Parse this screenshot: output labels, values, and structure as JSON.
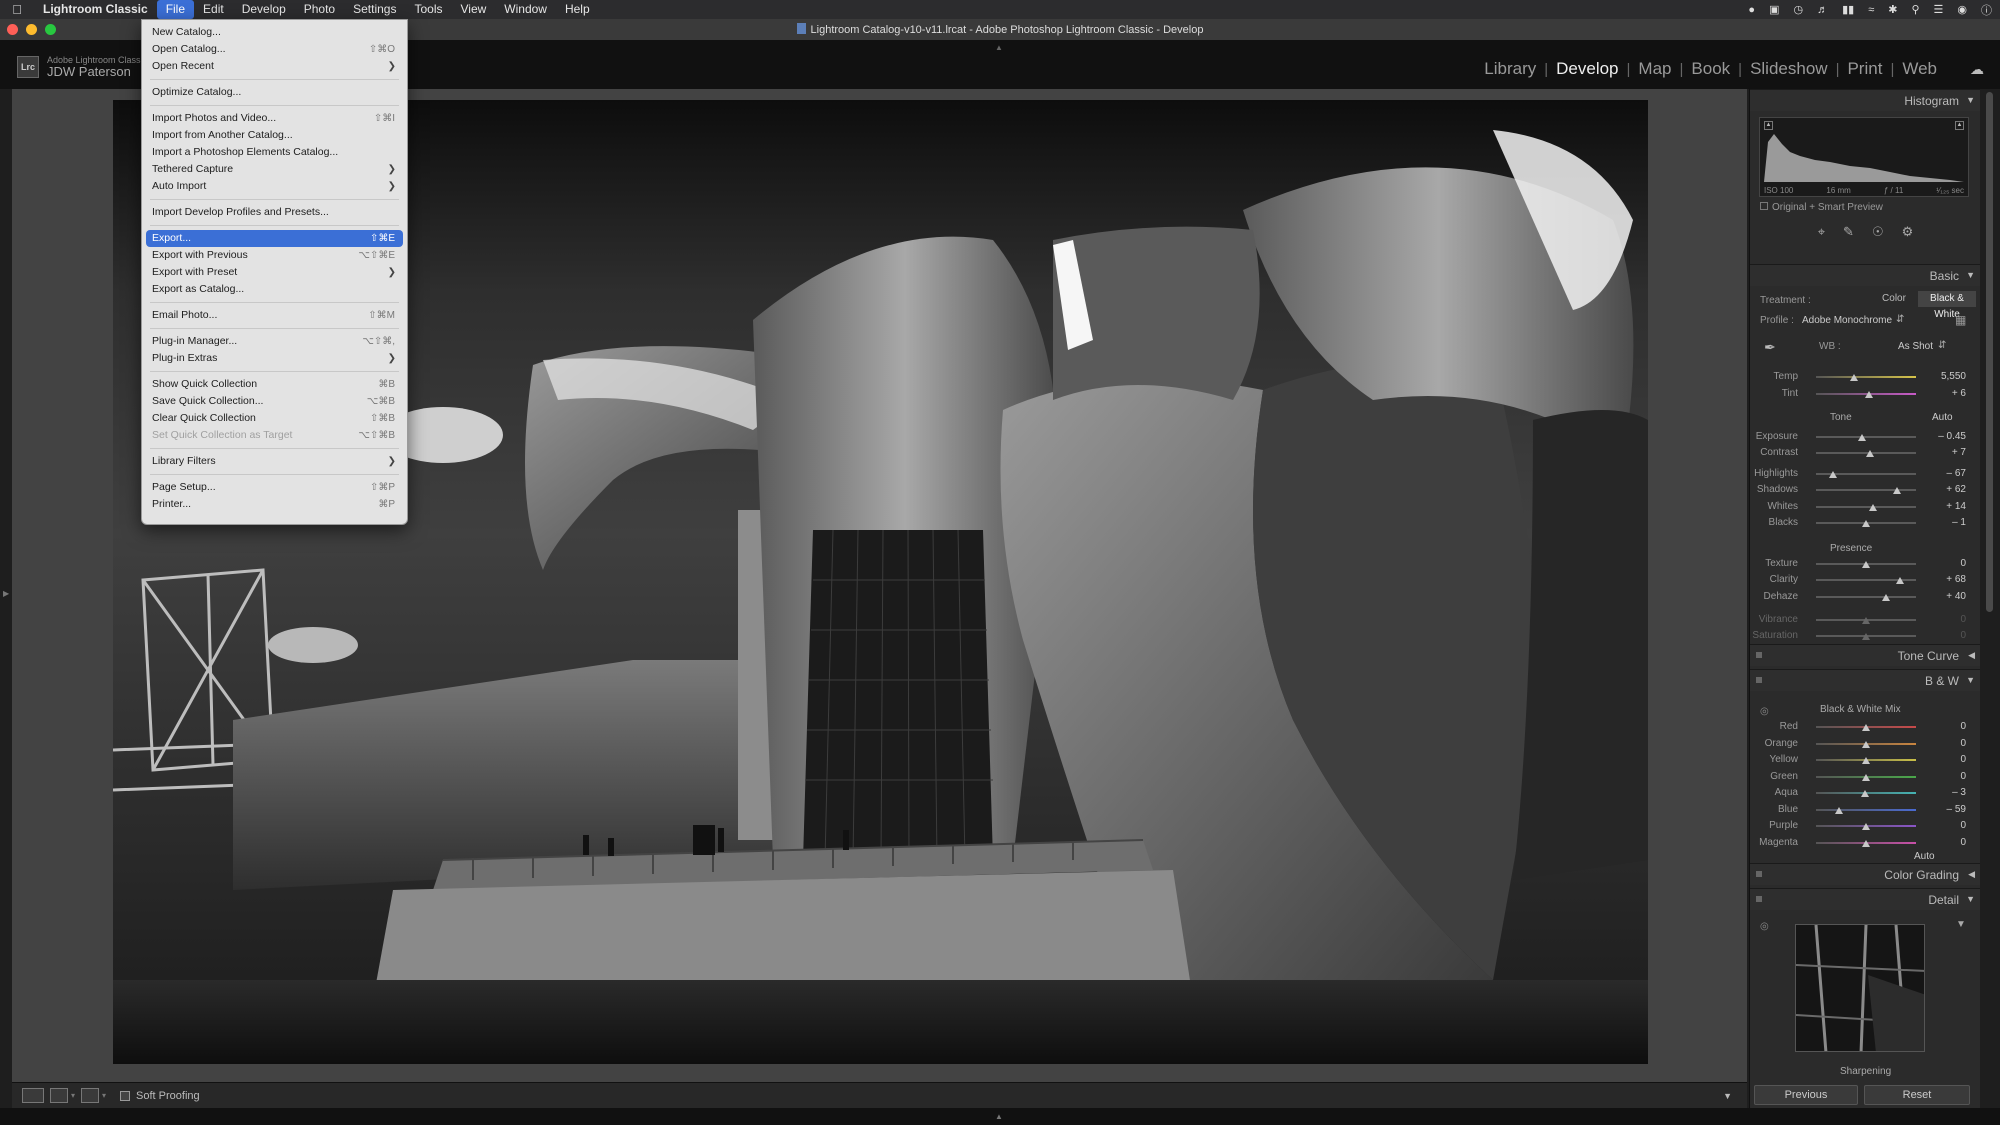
{
  "menubar": {
    "app_name": "Lightroom Classic",
    "items": [
      "File",
      "Edit",
      "Develop",
      "Photo",
      "Settings",
      "Tools",
      "View",
      "Window",
      "Help"
    ]
  },
  "window": {
    "title": "Lightroom Catalog-v10-v11.lrcat - Adobe Photoshop Lightroom Classic - Develop"
  },
  "identity_plate": {
    "badge": "Lrc",
    "line1": "Adobe Lightroom Classic",
    "line2": "JDW Paterson"
  },
  "modules": [
    "Library",
    "Develop",
    "Map",
    "Book",
    "Slideshow",
    "Print",
    "Web"
  ],
  "active_module": "Develop",
  "file_menu": {
    "groups": [
      [
        {
          "label": "New Catalog...",
          "shortcut": ""
        },
        {
          "label": "Open Catalog...",
          "shortcut": "⇧⌘O"
        },
        {
          "label": "Open Recent",
          "submenu": true
        }
      ],
      [
        {
          "label": "Optimize Catalog...",
          "shortcut": ""
        }
      ],
      [
        {
          "label": "Import Photos and Video...",
          "shortcut": "⇧⌘I"
        },
        {
          "label": "Import from Another Catalog...",
          "shortcut": ""
        },
        {
          "label": "Import a Photoshop Elements Catalog...",
          "shortcut": ""
        },
        {
          "label": "Tethered Capture",
          "submenu": true
        },
        {
          "label": "Auto Import",
          "submenu": true
        }
      ],
      [
        {
          "label": "Import Develop Profiles and Presets...",
          "shortcut": ""
        }
      ],
      [
        {
          "label": "Export...",
          "shortcut": "⇧⌘E",
          "highlighted": true
        },
        {
          "label": "Export with Previous",
          "shortcut": "⌥⇧⌘E"
        },
        {
          "label": "Export with Preset",
          "submenu": true
        },
        {
          "label": "Export as Catalog...",
          "shortcut": ""
        }
      ],
      [
        {
          "label": "Email Photo...",
          "shortcut": "⇧⌘M"
        }
      ],
      [
        {
          "label": "Plug-in Manager...",
          "shortcut": "⌥⇧⌘,"
        },
        {
          "label": "Plug-in Extras",
          "submenu": true
        }
      ],
      [
        {
          "label": "Show Quick Collection",
          "shortcut": "⌘B"
        },
        {
          "label": "Save Quick Collection...",
          "shortcut": "⌥⌘B"
        },
        {
          "label": "Clear Quick Collection",
          "shortcut": "⇧⌘B"
        },
        {
          "label": "Set Quick Collection as Target",
          "shortcut": "⌥⇧⌘B",
          "disabled": true
        }
      ],
      [
        {
          "label": "Library Filters",
          "submenu": true
        }
      ],
      [
        {
          "label": "Page Setup...",
          "shortcut": "⇧⌘P"
        },
        {
          "label": "Printer...",
          "shortcut": "⌘P"
        }
      ]
    ]
  },
  "toolbar": {
    "soft_proofing": "Soft Proofing"
  },
  "right_panel": {
    "histogram": {
      "title": "Histogram",
      "iso": "ISO 100",
      "focal": "16 mm",
      "aperture": "ƒ / 11",
      "shutter": "¹⁄₁₂₅ sec",
      "preview": "Original + Smart Preview"
    },
    "basic": {
      "title": "Basic",
      "treatment_label": "Treatment :",
      "treatment_color": "Color",
      "treatment_bw": "Black & White",
      "profile_label": "Profile :",
      "profile_value": "Adobe Monochrome",
      "wb_label": "WB :",
      "wb_value": "As Shot",
      "temp": {
        "label": "Temp",
        "value": "5,550",
        "pos": 0.38
      },
      "tint": {
        "label": "Tint",
        "value": "+ 6",
        "pos": 0.53
      },
      "tone_label": "Tone",
      "auto_label": "Auto",
      "tone": [
        {
          "label": "Exposure",
          "value": "– 0.45",
          "pos": 0.46
        },
        {
          "label": "Contrast",
          "value": "+ 7",
          "pos": 0.54
        },
        {
          "label": "Highlights",
          "value": "– 67",
          "pos": 0.17
        },
        {
          "label": "Shadows",
          "value": "+ 62",
          "pos": 0.81
        },
        {
          "label": "Whites",
          "value": "+ 14",
          "pos": 0.57
        },
        {
          "label": "Blacks",
          "value": "– 1",
          "pos": 0.5
        }
      ],
      "presence_label": "Presence",
      "presence": [
        {
          "label": "Texture",
          "value": "0",
          "pos": 0.5
        },
        {
          "label": "Clarity",
          "value": "+ 68",
          "pos": 0.84
        },
        {
          "label": "Dehaze",
          "value": "+ 40",
          "pos": 0.7
        },
        {
          "label": "Vibrance",
          "value": "0",
          "pos": 0.5,
          "disabled": true
        },
        {
          "label": "Saturation",
          "value": "0",
          "pos": 0.5,
          "disabled": true
        }
      ]
    },
    "tone_curve": "Tone Curve",
    "bw": {
      "title": "B & W",
      "mix_label": "Black & White Mix",
      "channels": [
        {
          "label": "Red",
          "value": "0",
          "pos": 0.5,
          "color": "#c84a4a"
        },
        {
          "label": "Orange",
          "value": "0",
          "pos": 0.5,
          "color": "#c9853f"
        },
        {
          "label": "Yellow",
          "value": "0",
          "pos": 0.5,
          "color": "#c9c048"
        },
        {
          "label": "Green",
          "value": "0",
          "pos": 0.5,
          "color": "#4aa84a"
        },
        {
          "label": "Aqua",
          "value": "– 3",
          "pos": 0.49,
          "color": "#45b3b3"
        },
        {
          "label": "Blue",
          "value": "– 59",
          "pos": 0.23,
          "color": "#4a6ad0"
        },
        {
          "label": "Purple",
          "value": "0",
          "pos": 0.5,
          "color": "#8a55c8"
        },
        {
          "label": "Magenta",
          "value": "0",
          "pos": 0.5,
          "color": "#c850a8"
        }
      ],
      "auto_label": "Auto"
    },
    "color_grading": "Color Grading",
    "detail": {
      "title": "Detail",
      "sharpening": "Sharpening"
    },
    "previous": "Previous",
    "reset": "Reset"
  }
}
